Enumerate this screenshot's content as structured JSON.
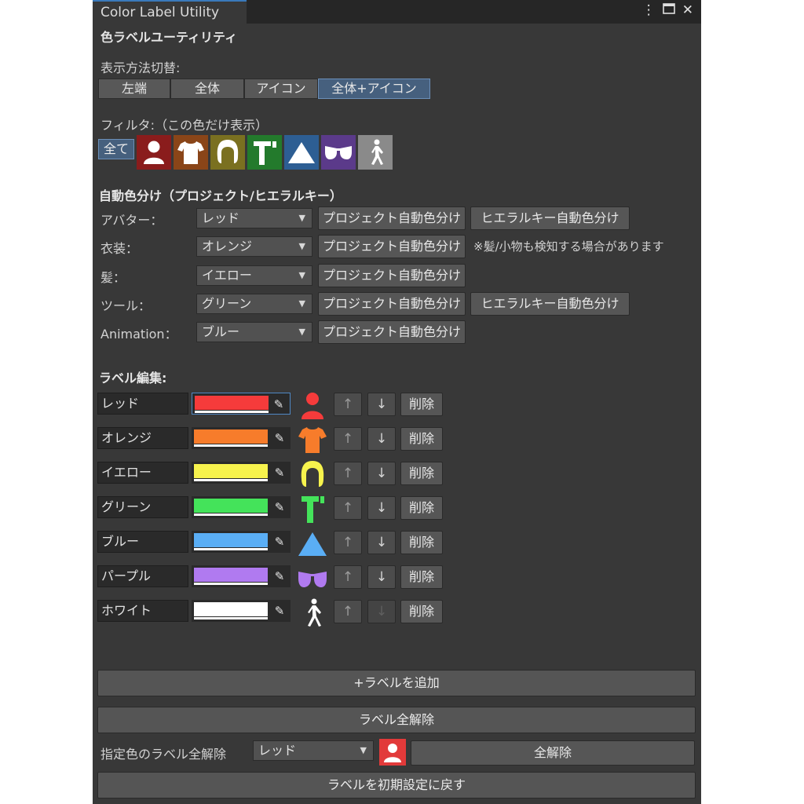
{
  "window": {
    "tab_title": "Color Label Utility",
    "icons": [
      "menu-dots-icon",
      "maximize-icon",
      "close-icon"
    ]
  },
  "header": {
    "title": "色ラベルユーティリティ"
  },
  "display_mode": {
    "label": "表示方法切替:",
    "options": [
      "左端",
      "全体",
      "アイコン",
      "全体+アイコン"
    ],
    "selected": "全体+アイコン"
  },
  "filter": {
    "label": "フィルタ:（この色だけ表示）",
    "all_label": "全て",
    "icons": [
      {
        "name": "red-avatar-filter-icon",
        "color": "#8a1c1c"
      },
      {
        "name": "orange-costume-filter-icon",
        "color": "#8a4518"
      },
      {
        "name": "yellow-hair-filter-icon",
        "color": "#7a7020"
      },
      {
        "name": "green-tool-filter-icon",
        "color": "#237a2c"
      },
      {
        "name": "blue-triangle-filter-icon",
        "color": "#2d5e93"
      },
      {
        "name": "purple-glasses-filter-icon",
        "color": "#5b3a8a"
      },
      {
        "name": "white-walker-filter-icon",
        "color": "#8a8a8a"
      }
    ]
  },
  "auto_color": {
    "title": "自動色分け（プロジェクト/ヒエラルキー）",
    "project_button": "プロジェクト自動色分け",
    "hierarchy_button": "ヒエラルキー自動色分け",
    "note": "※髪/小物も検知する場合があります",
    "rows": [
      {
        "label": "アバター：",
        "value": "レッド"
      },
      {
        "label": "衣装：",
        "value": "オレンジ"
      },
      {
        "label": "髪：",
        "value": "イエロー"
      },
      {
        "label": "ツール：",
        "value": "グリーン"
      },
      {
        "label": "Animation：",
        "value": "ブルー"
      }
    ]
  },
  "label_edit": {
    "title": "ラベル編集:",
    "up": "↑",
    "down": "↓",
    "delete": "削除",
    "rows": [
      {
        "name": "レッド",
        "color": "#f53b3b",
        "icon": "person-icon"
      },
      {
        "name": "オレンジ",
        "color": "#f77c2b",
        "icon": "shirt-icon"
      },
      {
        "name": "イエロー",
        "color": "#f7f34d",
        "icon": "hair-icon"
      },
      {
        "name": "グリーン",
        "color": "#44e35a",
        "icon": "tool-icon"
      },
      {
        "name": "ブルー",
        "color": "#5aaef5",
        "icon": "triangle-icon"
      },
      {
        "name": "パープル",
        "color": "#b07af0",
        "icon": "glasses-icon"
      },
      {
        "name": "ホワイト",
        "color": "#ffffff",
        "icon": "walker-icon"
      }
    ]
  },
  "actions": {
    "add_label": "+ラベルを追加",
    "clear_all": "ラベル全解除",
    "clear_by_color_label": "指定色のラベル全解除",
    "clear_by_color_value": "レッド",
    "clear_by_color_button": "全解除",
    "reset": "ラベルを初期設定に戻す"
  }
}
